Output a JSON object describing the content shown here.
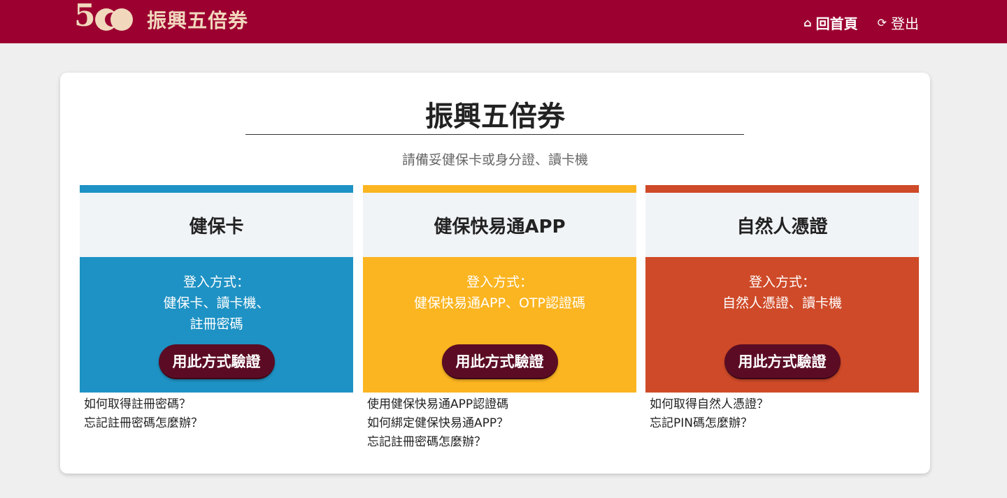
{
  "header": {
    "logo_text": "振興五倍券",
    "nav": {
      "home_label": "回首頁",
      "logout_label": "登出"
    }
  },
  "main": {
    "title": "振興五倍券",
    "subtitle": "請備妥健保卡或身分證、讀卡機",
    "methods": [
      {
        "name": "健保卡",
        "color": "#1e92c4",
        "desc_lines": [
          "登入方式：",
          "健保卡、讀卡機、",
          "註冊密碼"
        ],
        "button_label": "用此方式驗證",
        "help_links": [
          "如何取得註冊密碼？",
          "忘記註冊密碼怎麼辦？"
        ]
      },
      {
        "name": "健保快易通APP",
        "color": "#fbb521",
        "desc_lines": [
          "登入方式：",
          "健保快易通APP、OTP認證碼"
        ],
        "button_label": "用此方式驗證",
        "help_links": [
          "使用健保快易通APP認證碼",
          "如何綁定健保快易通APP？",
          "忘記註冊密碼怎麼辦？"
        ]
      },
      {
        "name": "自然人憑證",
        "color": "#cf4a28",
        "desc_lines": [
          "登入方式：",
          "自然人憑證、讀卡機"
        ],
        "button_label": "用此方式驗證",
        "help_links": [
          "如何取得自然人憑證？",
          "忘記PIN碼怎麼辦？"
        ]
      }
    ]
  },
  "colors": {
    "header_bg": "#9c0030",
    "logo": "#f1d8bd",
    "button": "#5b0c24"
  },
  "icons": {
    "home": "home-icon",
    "logout": "logout-icon"
  }
}
